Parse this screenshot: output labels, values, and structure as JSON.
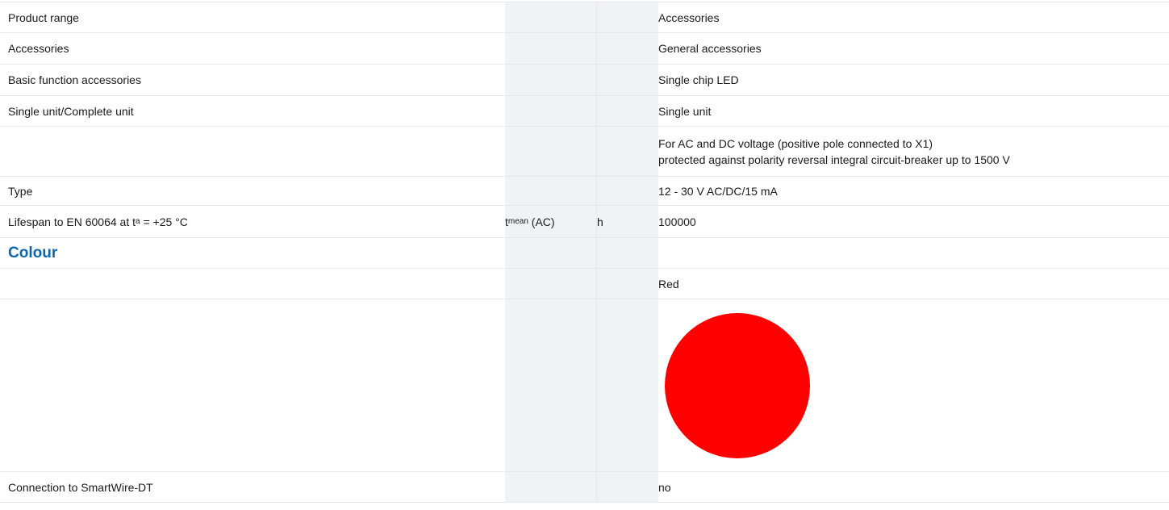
{
  "rows": [
    {
      "label": "Product range",
      "symbol": "",
      "unit": "",
      "value": "Accessories"
    },
    {
      "label": "Accessories",
      "symbol": "",
      "unit": "",
      "value": "General accessories"
    },
    {
      "label": "Basic function accessories",
      "symbol": "",
      "unit": "",
      "value": "Single chip LED"
    },
    {
      "label": "Single unit/Complete unit",
      "symbol": "",
      "unit": "",
      "value": "Single unit"
    },
    {
      "label": "",
      "symbol": "",
      "unit": "",
      "value_lines": [
        "For AC and DC voltage (positive pole connected to X1)",
        "protected against polarity reversal integral circuit-breaker up to 1500 V"
      ]
    },
    {
      "label": "Type",
      "symbol": "",
      "unit": "",
      "value": "12 - 30 V AC/DC/15 mA"
    },
    {
      "label_prefix": "Lifespan to EN 60064 at t",
      "label_sub": "a",
      "label_suffix": " = +25 °C",
      "symbol_main": "t",
      "symbol_sub": "mean",
      "symbol_suffix": " (AC)",
      "unit": "h",
      "value": "100000"
    },
    {
      "heading": "Colour"
    },
    {
      "label": "",
      "symbol": "",
      "unit": "",
      "value": "Red"
    },
    {
      "swatch_color": "#ff0000"
    },
    {
      "label": "Connection to SmartWire-DT",
      "symbol": "",
      "unit": "",
      "value": "no"
    }
  ]
}
